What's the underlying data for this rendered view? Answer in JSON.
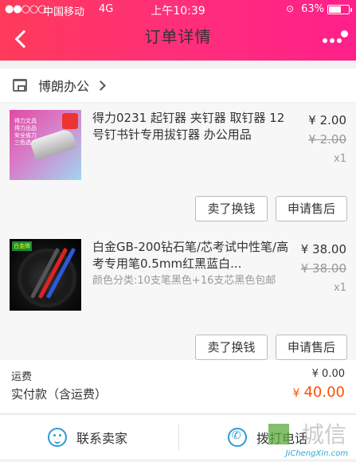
{
  "status_bar": {
    "signal": "●●○○○",
    "carrier": "中国移动",
    "network": "4G",
    "time": "上午10:39",
    "battery": "63%",
    "battery_level": 0.63
  },
  "nav": {
    "title": "订单详情"
  },
  "shop": {
    "name": "博朗办公"
  },
  "items": [
    {
      "title": "得力0231 起钉器 夹钉器 取钉器 12号钉书针专用拔钉器 办公用品",
      "spec": "",
      "price": "¥ 2.00",
      "original_price": "¥ 2.00",
      "quantity": "x1",
      "thumb_text": "得力文具 得力出品 安全省力 三色选",
      "sell_label": "卖了换钱",
      "after_sale_label": "申请售后"
    },
    {
      "title": "白金GB-200钻石笔/芯考试中性笔/高考专用笔0.5mm红黑蓝白...",
      "spec": "颜色分类:10支笔黑色+16支芯黑色包邮",
      "price": "¥ 38.00",
      "original_price": "¥ 38.00",
      "quantity": "x1",
      "thumb_text": "白金牌",
      "sell_label": "卖了换钱",
      "after_sale_label": "申请售后"
    }
  ],
  "totals": {
    "shipping_label": "运费",
    "shipping_value": "¥ 0.00",
    "paid_label": "实付款（含运费）",
    "paid_currency": "¥",
    "paid_amount": "40.00"
  },
  "contact": {
    "chat_label": "联系卖家",
    "phone_label": "拨打电话"
  },
  "watermark": {
    "text": "城信",
    "url": "JiChengXin.com"
  },
  "colors": {
    "header_start": "#ff3a5a",
    "header_end": "#ff1f8a",
    "price_accent": "#ff5000",
    "icon_blue": "#2a9ad8"
  }
}
